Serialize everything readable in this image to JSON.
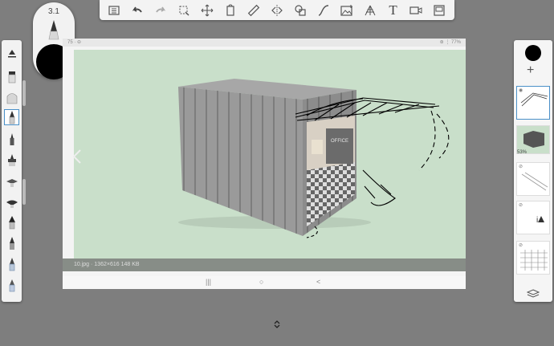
{
  "brush": {
    "size": "3.1",
    "color": "#000000"
  },
  "toolbar": {
    "items": [
      "list-icon",
      "undo-icon",
      "redo-icon",
      "select-icon",
      "transform-icon",
      "note-icon",
      "ruler-icon",
      "symmetry-icon",
      "shapes-icon",
      "curve-icon",
      "image-icon",
      "perspective-icon",
      "text-tool",
      "video-icon",
      "canvas-icon"
    ],
    "text_tool_label": "T"
  },
  "photo": {
    "status_left": "75 · ⊖",
    "status_right": "⊛ ⋮ 77%",
    "file_info": "10.jpg · 1362×616 148 KB",
    "sign_text": "OFFICE"
  },
  "nav": {
    "recent": "|||",
    "home": "○",
    "back": "<"
  },
  "layers": {
    "opacity": "53%"
  },
  "colors": {
    "accent": "#4a90c8",
    "canvas_bg": "#c9dfca",
    "app_bg": "#7e7e7e"
  }
}
